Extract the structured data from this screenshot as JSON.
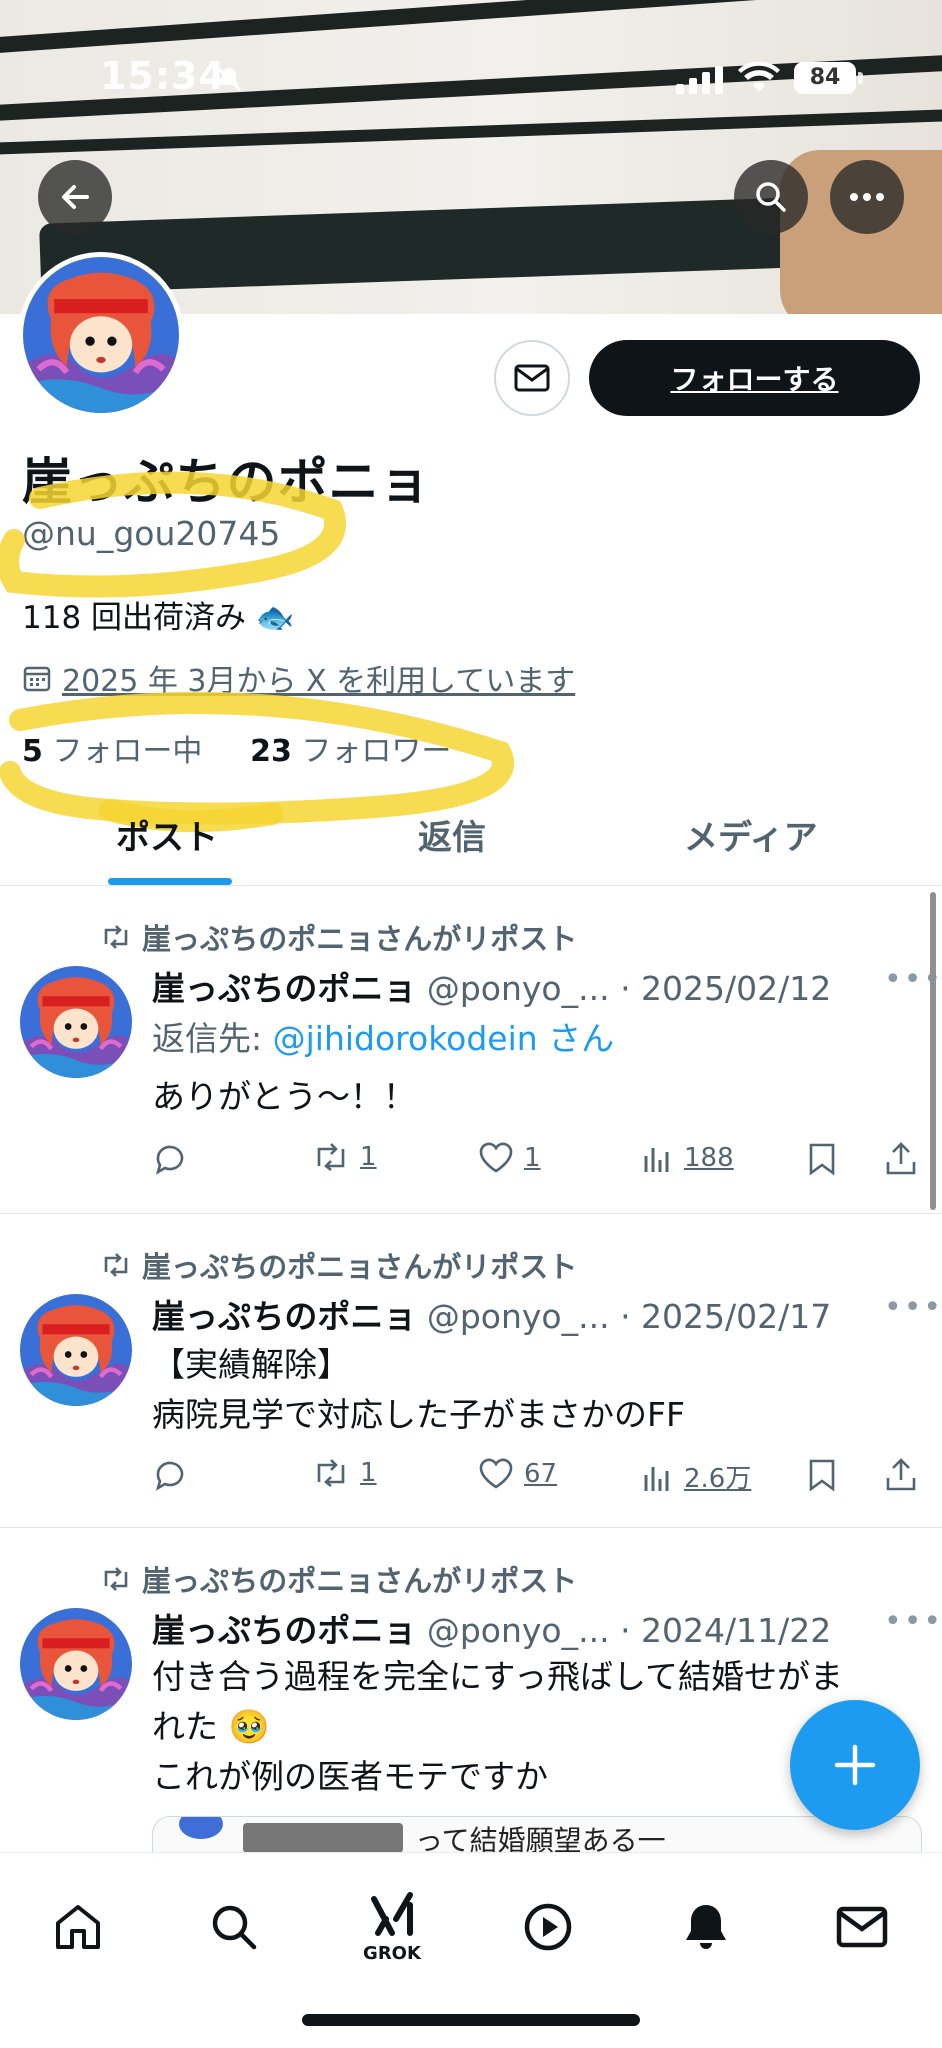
{
  "status_bar": {
    "time": "15:34",
    "battery": "84"
  },
  "profile": {
    "name": "崖っぷちのポニョ",
    "handle": "@nu_gou20745",
    "bio": "118 回出荷済み 🐟",
    "joined": "2025 年 3月から X を利用しています",
    "following_count": "5",
    "following_label": "フォロー中",
    "followers_count": "23",
    "followers_label": "フォロワー",
    "follow_button": "フォローする"
  },
  "tabs": [
    {
      "label": "ポスト",
      "active": true
    },
    {
      "label": "返信",
      "active": false
    },
    {
      "label": "メディア",
      "active": false
    }
  ],
  "posts": [
    {
      "repost_label": "崖っぷちのポニョさんがリポスト",
      "author": "崖っぷちのポニョ",
      "meta": "@ponyo_... · 2025/02/12",
      "reply_prefix": "返信先: ",
      "reply_handle": "@jihidorokodein",
      "reply_suffix": " さん",
      "text": "ありがとう〜！！",
      "retweets": "1",
      "likes": "1",
      "views": "188"
    },
    {
      "repost_label": "崖っぷちのポニョさんがリポスト",
      "author": "崖っぷちのポニョ",
      "meta": "@ponyo_... · 2025/02/17",
      "text_line1": "【実績解除】",
      "text_line2": "病院見学で対応した子がまさかのFF",
      "retweets": "1",
      "likes": "67",
      "views": "2.6万"
    },
    {
      "repost_label": "崖っぷちのポニョさんがリポスト",
      "author": "崖っぷちのポニョ",
      "meta": "@ponyo_... · 2024/11/22",
      "text_line1": "付き合う過程を完全にすっ飛ばして結婚せがま",
      "text_line2": "れた 🥹",
      "text_line3": "これが例の医者モテですか",
      "embed_text": "って結婚願望ある一"
    }
  ],
  "nav": {
    "grok_label": "GROK"
  },
  "colors": {
    "accent": "#1d9bf0",
    "highlight": "#f6d533"
  }
}
